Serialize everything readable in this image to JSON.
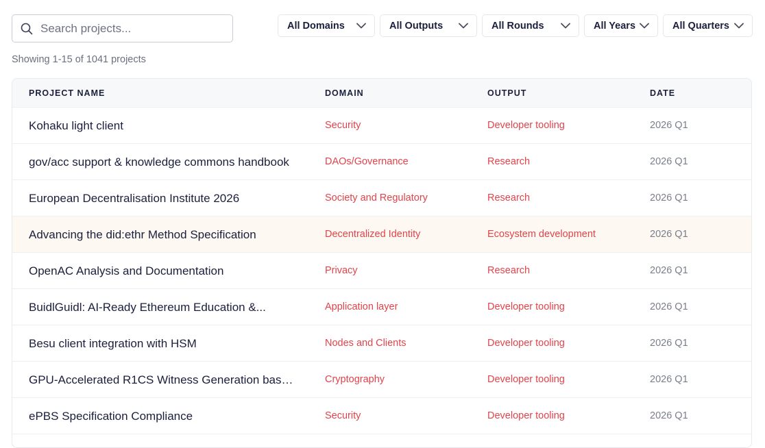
{
  "search": {
    "placeholder": "Search projects..."
  },
  "filters": [
    {
      "label": "All Domains"
    },
    {
      "label": "All Outputs"
    },
    {
      "label": "All Rounds"
    },
    {
      "label": "All Years"
    },
    {
      "label": "All Quarters"
    }
  ],
  "summary": {
    "text": "Showing 1-15 of 1041 projects"
  },
  "table": {
    "headers": {
      "name": "PROJECT NAME",
      "domain": "DOMAIN",
      "output": "OUTPUT",
      "date": "DATE"
    },
    "rows": [
      {
        "name": "Kohaku light client",
        "domain": "Security",
        "output": "Developer tooling",
        "date": "2026 Q1"
      },
      {
        "name": "gov/acc support & knowledge commons handbook",
        "domain": "DAOs/Governance",
        "output": "Research",
        "date": "2026 Q1"
      },
      {
        "name": "European Decentralisation Institute 2026",
        "domain": "Society and Regulatory",
        "output": "Research",
        "date": "2026 Q1"
      },
      {
        "name": "Advancing the did:ethr Method Specification",
        "domain": "Decentralized Identity",
        "output": "Ecosystem development",
        "date": "2026 Q1"
      },
      {
        "name": "OpenAC Analysis and Documentation",
        "domain": "Privacy",
        "output": "Research",
        "date": "2026 Q1"
      },
      {
        "name": "BuidlGuidl: AI-Ready Ethereum Education &...",
        "domain": "Application layer",
        "output": "Developer tooling",
        "date": "2026 Q1"
      },
      {
        "name": "Besu client integration with HSM",
        "domain": "Nodes and Clients",
        "output": "Developer tooling",
        "date": "2026 Q1"
      },
      {
        "name": "GPU-Accelerated R1CS Witness Generation base...",
        "domain": "Cryptography",
        "output": "Developer tooling",
        "date": "2026 Q1"
      },
      {
        "name": "ePBS Specification Compliance",
        "domain": "Security",
        "output": "Developer tooling",
        "date": "2026 Q1"
      }
    ]
  }
}
